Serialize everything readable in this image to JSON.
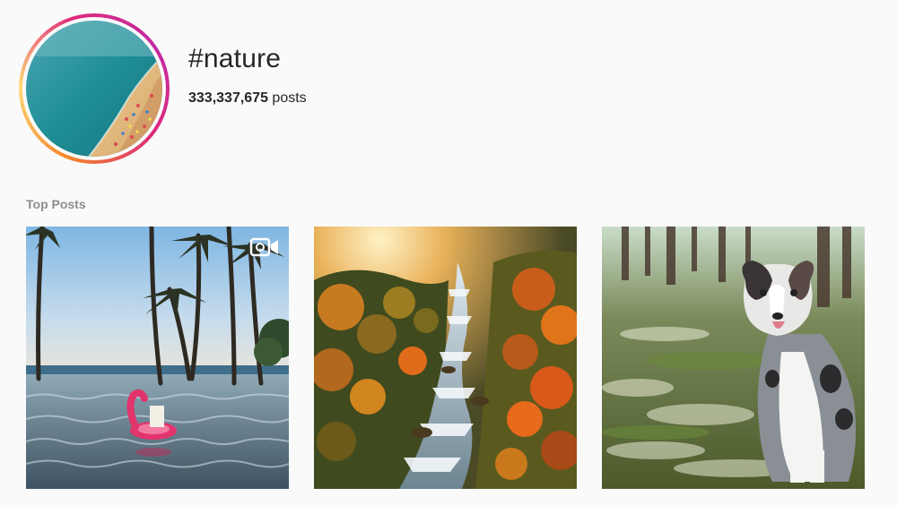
{
  "hashtag": {
    "title": "#nature",
    "post_count": "333,337,675",
    "post_suffix": " posts"
  },
  "section": {
    "top_posts_label": "Top Posts"
  },
  "posts": [
    {
      "kind": "video",
      "icon": "video-icon",
      "subject": "infinity pool with palm trees and flamingo float"
    },
    {
      "kind": "image",
      "subject": "waterfall through autumn forest"
    },
    {
      "kind": "image",
      "subject": "australian shepherd dog in forest"
    }
  ],
  "colors": {
    "background": "#fafafa",
    "text": "#262626",
    "muted": "#8e8e8e",
    "ring_start": "#f58529",
    "ring_end": "#dd2a7b"
  }
}
